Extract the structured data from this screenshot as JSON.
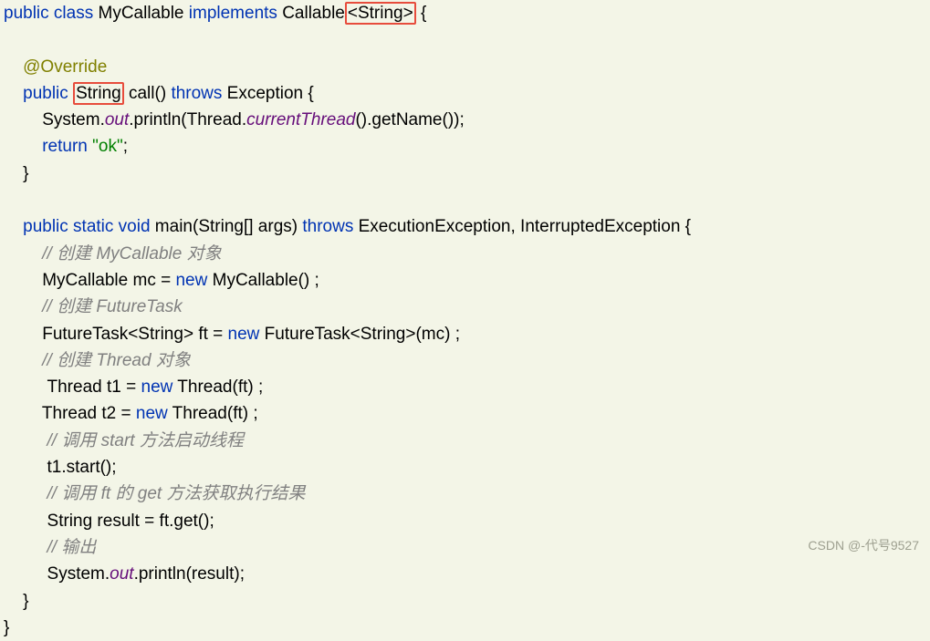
{
  "line1": {
    "kw1": "public class",
    "cls": "MyCallable",
    "kw2": "implements",
    "iface": "Callable",
    "gen": "<String>",
    "brace": " {"
  },
  "blank1": "",
  "line3": {
    "ann": "@Override"
  },
  "line4": {
    "kw1": "public",
    "box": "String",
    "mth": "call",
    "paren": "() ",
    "kw2": "throws",
    "exc": " Exception {"
  },
  "line5": {
    "pre": "System.",
    "out": "out",
    "mid": ".println(Thread.",
    "ct": "currentThread",
    "post": "().getName());"
  },
  "line6": {
    "kw": "return",
    "sp": " ",
    "str": "\"ok\"",
    "semi": ";"
  },
  "line7": "}",
  "blank2": "",
  "line9": {
    "kw1": "public static void",
    "mth": " main",
    "args": "(String[] args) ",
    "kw2": "throws",
    "exc": " ExecutionException, InterruptedException {"
  },
  "line10": "// 创建 MyCallable 对象",
  "line11": {
    "pre": "MyCallable mc = ",
    "kw": "new",
    "post": " MyCallable() ;"
  },
  "line12": "// 创建 FutureTask",
  "line13": {
    "pre": "FutureTask<String> ft = ",
    "kw": "new",
    "post": " FutureTask<String>(mc) ;"
  },
  "line14": "// 创建 Thread 对象",
  "line15": {
    "pre": " Thread t1 = ",
    "kw": "new",
    "post": " Thread(ft) ;"
  },
  "line16": {
    "pre": "Thread t2 = ",
    "kw": "new",
    "post": " Thread(ft) ;"
  },
  "line17": "// 调用 start 方法启动线程",
  "line18": "t1.start();",
  "line19": "// 调用 ft 的 get 方法获取执行结果",
  "line20": "String result = ft.get();",
  "line21": "// 输出",
  "line22": {
    "pre": "System.",
    "out": "out",
    "post": ".println(result);"
  },
  "line23": "}",
  "line24": "}",
  "watermark": "CSDN @-代号9527"
}
